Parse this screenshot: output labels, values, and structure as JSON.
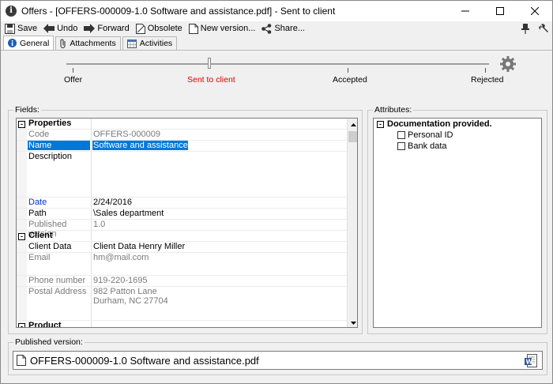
{
  "window": {
    "title": "Offers - [OFFERS-000009-1.0 Software and assistance.pdf] - Sent to client"
  },
  "toolbar": {
    "save": "Save",
    "undo": "Undo",
    "forward": "Forward",
    "obsolete": "Obsolete",
    "new_version": "New version...",
    "share": "Share..."
  },
  "tabs": [
    "General",
    "Attachments",
    "Activities"
  ],
  "workflow": {
    "stages": [
      "Offer",
      "Sent to client",
      "Accepted",
      "Rejected"
    ],
    "current": "Sent to client",
    "current_color": "#e00000"
  },
  "fields": {
    "label": "Fields:",
    "rows": {
      "properties": "Properties",
      "code_label": "Code",
      "code_value": "OFFERS-000009",
      "name_label": "Name",
      "name_value": "Software and assistance",
      "description_label": "Description",
      "date_label": "Date",
      "date_value": "2/24/2016",
      "path_label": "Path",
      "path_value": "\\Sales department",
      "pubver_label": "Published version",
      "pubver_value": "1.0",
      "client": "Client",
      "clientdata_label": "Client Data",
      "clientdata_value": "Client Data Henry Miller",
      "email_label": "Email",
      "email_value": "hm@mail.com",
      "phone_label": "Phone number",
      "phone_value": "919-220-1695",
      "postal_label": "Postal Address",
      "postal_line1": "982 Patton Lane",
      "postal_line2": "Durham, NC 27704",
      "product": "Product"
    }
  },
  "attributes": {
    "label": "Attributes:",
    "group": "Documentation provided.",
    "items": [
      "Personal ID",
      "Bank data"
    ]
  },
  "published": {
    "label": "Published version:",
    "file": "OFFERS-000009-1.0 Software and assistance.pdf"
  },
  "colors": {
    "selection": "#0078d7",
    "link_blue": "#0033cc"
  }
}
